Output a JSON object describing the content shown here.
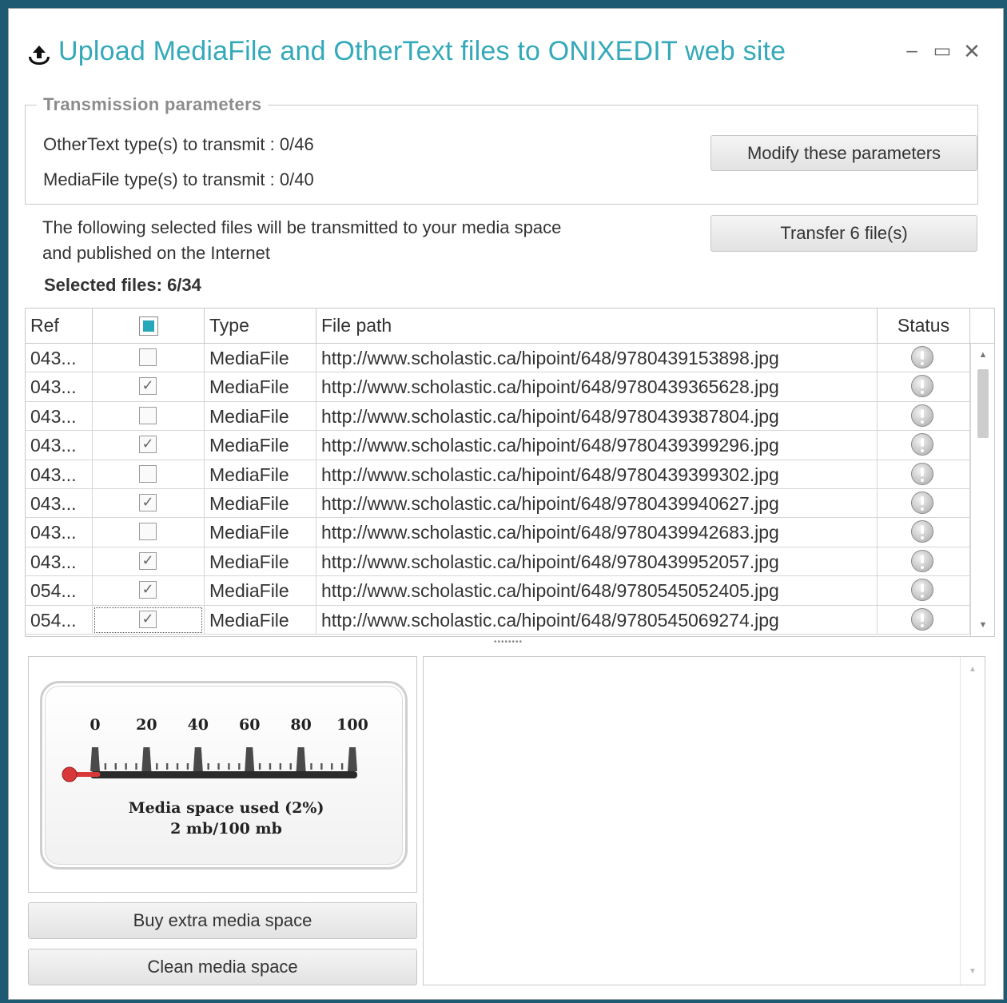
{
  "window": {
    "title": "Upload MediaFile and OtherText files to ONIXEDIT web site",
    "minimize": "–",
    "maximize": "▭",
    "close": "✕"
  },
  "params": {
    "legend": "Transmission parameters",
    "othertext_line": "OtherText type(s) to transmit : 0/46",
    "mediafile_line": "MediaFile type(s) to transmit : 0/40",
    "modify_button": "Modify these parameters"
  },
  "info": {
    "line1": "The following selected files will be transmitted to your media space",
    "line2": "and published on the Internet",
    "transfer_button": "Transfer 6 file(s)",
    "selected_count": "Selected files: 6/34"
  },
  "table": {
    "columns": [
      "Ref",
      "",
      "Type",
      "File path",
      "Status"
    ],
    "rows": [
      {
        "ref": "043...",
        "checked": false,
        "type": "MediaFile",
        "path": "http://www.scholastic.ca/hipoint/648/9780439153898.jpg"
      },
      {
        "ref": "043...",
        "checked": true,
        "type": "MediaFile",
        "path": "http://www.scholastic.ca/hipoint/648/9780439365628.jpg"
      },
      {
        "ref": "043...",
        "checked": false,
        "type": "MediaFile",
        "path": "http://www.scholastic.ca/hipoint/648/9780439387804.jpg"
      },
      {
        "ref": "043...",
        "checked": true,
        "type": "MediaFile",
        "path": "http://www.scholastic.ca/hipoint/648/9780439399296.jpg"
      },
      {
        "ref": "043...",
        "checked": false,
        "type": "MediaFile",
        "path": "http://www.scholastic.ca/hipoint/648/9780439399302.jpg"
      },
      {
        "ref": "043...",
        "checked": true,
        "type": "MediaFile",
        "path": "http://www.scholastic.ca/hipoint/648/9780439940627.jpg"
      },
      {
        "ref": "043...",
        "checked": false,
        "type": "MediaFile",
        "path": "http://www.scholastic.ca/hipoint/648/9780439942683.jpg"
      },
      {
        "ref": "043...",
        "checked": true,
        "type": "MediaFile",
        "path": "http://www.scholastic.ca/hipoint/648/9780439952057.jpg"
      },
      {
        "ref": "054...",
        "checked": true,
        "type": "MediaFile",
        "path": "http://www.scholastic.ca/hipoint/648/9780545052405.jpg"
      },
      {
        "ref": "054...",
        "checked": true,
        "type": "MediaFile",
        "path": "http://www.scholastic.ca/hipoint/648/9780545069274.jpg",
        "focused": true
      }
    ],
    "status_icon": "exclamation-circle-icon"
  },
  "gauge": {
    "ticks": [
      "0",
      "20",
      "40",
      "60",
      "80",
      "100"
    ],
    "used_percent": 2,
    "label1": "Media space used (2%)",
    "label2": "2 mb/100 mb",
    "accent_color": "#d9383a"
  },
  "buttons": {
    "buy": "Buy extra media space",
    "clean": "Clean media space"
  },
  "colors": {
    "title": "#34a9b9",
    "header_checkbox": "#27a8b8"
  }
}
